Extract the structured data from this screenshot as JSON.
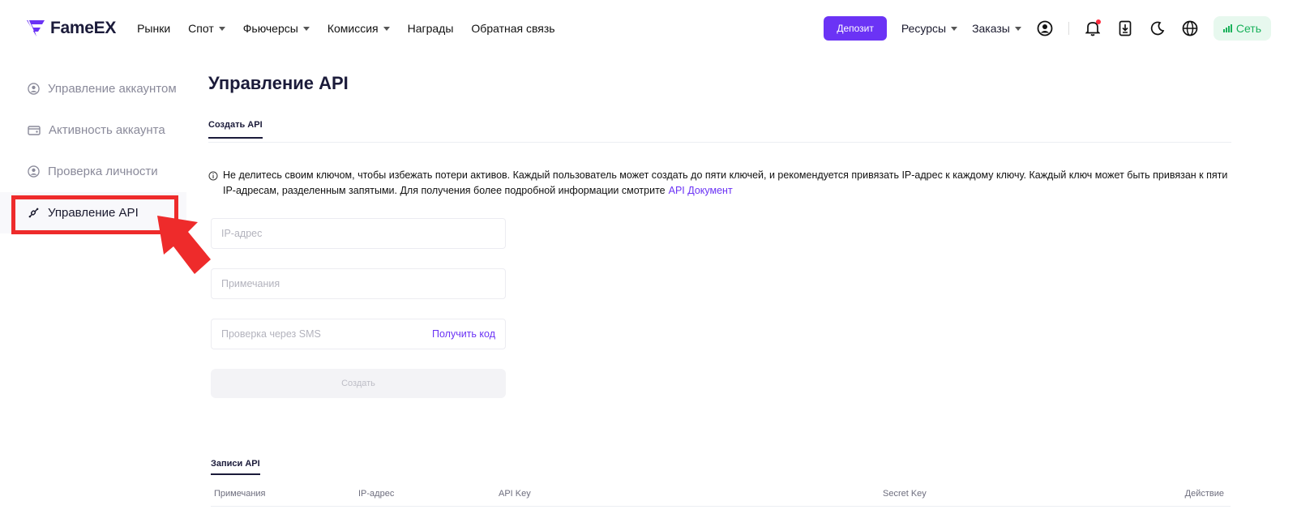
{
  "header": {
    "logo_text": "FameEX",
    "nav": [
      {
        "label": "Рынки",
        "dropdown": false
      },
      {
        "label": "Спот",
        "dropdown": true
      },
      {
        "label": "Фьючерсы",
        "dropdown": true
      },
      {
        "label": "Комиссия",
        "dropdown": true
      },
      {
        "label": "Награды",
        "dropdown": false
      },
      {
        "label": "Обратная связь",
        "dropdown": false
      }
    ],
    "deposit_label": "Депозит",
    "resources_label": "Ресурсы",
    "orders_label": "Заказы",
    "network_label": "Сеть",
    "icons": [
      "user-icon",
      "bell-icon",
      "download-icon",
      "moon-icon",
      "globe-icon"
    ]
  },
  "sidebar": {
    "items": [
      {
        "label": "Управление аккаунтом",
        "icon": "user-circle-icon",
        "active": false
      },
      {
        "label": "Активность аккаунта",
        "icon": "wallet-icon",
        "active": false
      },
      {
        "label": "Проверка личности",
        "icon": "id-icon",
        "active": false
      },
      {
        "label": "Управление API",
        "icon": "link-icon",
        "active": true
      }
    ]
  },
  "main": {
    "title": "Управление API",
    "tab_label": "Создать API",
    "notice": "Не делитесь своим ключом, чтобы избежать потери активов. Каждый пользователь может создать до пяти ключей, и рекомендуется привязать IP-адрес к каждому ключу. Каждый ключ может быть привязан к пяти IP-адресам, разделенным запятыми. Для получения более подробной информации смотрите",
    "notice_link": "API Документ",
    "ip_placeholder": "IP-адрес",
    "notes_placeholder": "Примечания",
    "sms_placeholder": "Проверка через SMS",
    "get_code_label": "Получить код",
    "create_label": "Создать",
    "records_tab": "Записи API",
    "table_headers": [
      "Примечания",
      "IP-адрес",
      "API Key",
      "Secret Key",
      "Действие"
    ]
  },
  "colors": {
    "accent": "#6b33f5",
    "network_green": "#18b15a",
    "highlight_red": "#ee2b2b"
  }
}
